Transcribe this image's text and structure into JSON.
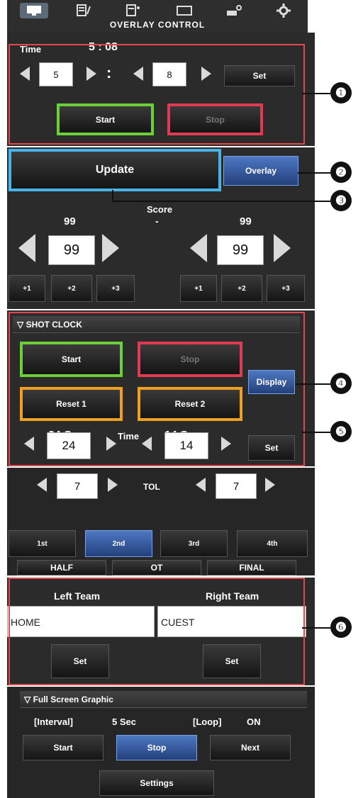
{
  "toolbar": {
    "title": "OVERLAY CONTROL",
    "icons": [
      "monitor-icon",
      "notes-icon",
      "edit-icon",
      "window-icon",
      "camera-settings-icon",
      "gear-icon"
    ]
  },
  "timer": {
    "label": "Time",
    "display": "5 : 08",
    "minutes": "5",
    "colon": ":",
    "seconds": "8",
    "set": "Set",
    "start": "Start",
    "stop": "Stop"
  },
  "overlay": {
    "update": "Update",
    "overlay": "Overlay"
  },
  "score": {
    "label": "Score",
    "dash": "-",
    "left_display": "99",
    "right_display": "99",
    "left_value": "99",
    "right_value": "99",
    "increments": [
      "+1",
      "+2",
      "+3"
    ]
  },
  "shot_clock": {
    "header": "▽ SHOT CLOCK",
    "start": "Start",
    "stop": "Stop",
    "display": "Display",
    "reset1": "Reset 1",
    "reset2": "Reset 2",
    "left_label": "24 Sec",
    "time_label": "Time",
    "right_label": "14 Sec",
    "left_value": "24",
    "right_value": "14",
    "set": "Set"
  },
  "tol": {
    "label": "TOL",
    "left_value": "7",
    "right_value": "7"
  },
  "periods": {
    "buttons": [
      "1st",
      "2nd",
      "3rd",
      "4th"
    ],
    "selected": "2nd",
    "stages": [
      "HALF",
      "OT",
      "FINAL"
    ]
  },
  "teams": {
    "left_label": "Left Team",
    "right_label": "Right Team",
    "left_value": "HOME",
    "right_value": "CUEST",
    "set": "Set"
  },
  "full_screen": {
    "header": "▽ Full Screen Graphic",
    "interval_label": "[Interval]",
    "interval_value": "5 Sec",
    "loop_label": "[Loop]",
    "loop_value": "ON",
    "start": "Start",
    "stop": "Stop",
    "next": "Next",
    "settings": "Settings"
  },
  "callouts": [
    "❶",
    "❷",
    "❸",
    "❹",
    "❺",
    "❻"
  ],
  "colors": {
    "highlight_green": "#6ccf3a",
    "highlight_red": "#e03b55",
    "highlight_orange": "#f0a020",
    "highlight_cyan": "#46b4e6",
    "active_blue": "#3b63b0",
    "callout_box_red": "#e0484e"
  }
}
